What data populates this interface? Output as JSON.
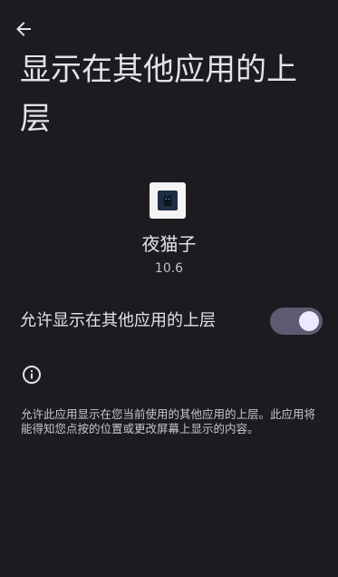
{
  "header": {
    "back_icon": "arrow-back-icon",
    "title": "显示在其他应用的上层"
  },
  "app": {
    "icon": "app-icon",
    "name": "夜猫子",
    "version": "10.6"
  },
  "setting": {
    "label": "允许显示在其他应用的上层",
    "enabled": true
  },
  "info": {
    "icon": "info-icon",
    "description": "允许此应用显示在您当前使用的其他应用的上层。此应用将能得知您点按的位置或更改屏幕上显示的内容。"
  },
  "colors": {
    "background": "#1c1b1f",
    "toggle_track": "#5d5a72",
    "toggle_thumb": "#efe9ff"
  }
}
